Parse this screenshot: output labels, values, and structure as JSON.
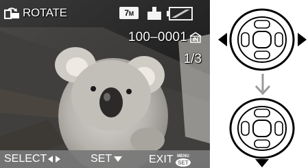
{
  "screen": {
    "title": "ROTATE",
    "resolution_badge": {
      "value": "7",
      "unit": "M"
    },
    "file_number": "100–0001",
    "image_count": "1/3"
  },
  "bottom_bar": {
    "select_label": "SELECT",
    "set_label": "SET",
    "exit_label": "EXIT",
    "exit_key_top": "MENU",
    "exit_key_bottom": "SET"
  },
  "icons": {
    "rotate": "rotate-icon",
    "aspect": "aspect-ratio-icon",
    "battery": "battery-icon",
    "folder": "in-folder-icon",
    "left_right": "left-right-arrows-icon",
    "down": "down-triangle-icon",
    "process_arrow": "down-arrow-icon"
  },
  "diagram": {
    "top_dial_highlight": [
      "left",
      "right"
    ],
    "bottom_dial_highlight": [
      "down"
    ]
  },
  "colors": {
    "arrow": "#9a9a9a",
    "triangle": "#000000",
    "bar": "#787878"
  }
}
